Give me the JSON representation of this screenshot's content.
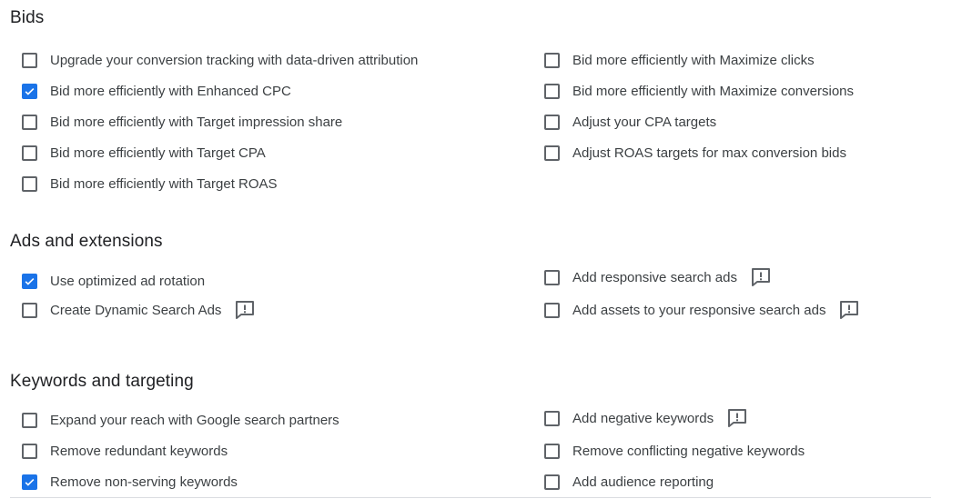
{
  "sections": {
    "bids": {
      "title": "Bids",
      "items": [
        {
          "label": "Upgrade your conversion tracking with data-driven attribution",
          "checked": false
        },
        {
          "label": "Bid more efficiently with Enhanced CPC",
          "checked": true
        },
        {
          "label": "Bid more efficiently with Target impression share",
          "checked": false
        },
        {
          "label": "Bid more efficiently with Target CPA",
          "checked": false
        },
        {
          "label": "Bid more efficiently with Target ROAS",
          "checked": false
        },
        {
          "label": "Bid more efficiently with Maximize clicks",
          "checked": false
        },
        {
          "label": "Bid more efficiently with Maximize conversions",
          "checked": false
        },
        {
          "label": "Adjust your CPA targets",
          "checked": false
        },
        {
          "label": "Adjust ROAS targets for max conversion bids",
          "checked": false
        }
      ]
    },
    "ads": {
      "title": "Ads and extensions",
      "items": [
        {
          "label": "Use optimized ad rotation",
          "checked": true,
          "feedback_icon": false
        },
        {
          "label": "Create Dynamic Search Ads",
          "checked": false,
          "feedback_icon": true
        },
        {
          "label": "Add responsive search ads",
          "checked": false,
          "feedback_icon": true
        },
        {
          "label": "Add assets to your responsive search ads",
          "checked": false,
          "feedback_icon": true
        }
      ]
    },
    "keywords": {
      "title": "Keywords and targeting",
      "items": [
        {
          "label": "Expand your reach with Google search partners",
          "checked": false,
          "feedback_icon": false
        },
        {
          "label": "Remove redundant keywords",
          "checked": false,
          "feedback_icon": false
        },
        {
          "label": "Remove non-serving keywords",
          "checked": true,
          "feedback_icon": false
        },
        {
          "label": "Add negative keywords",
          "checked": false,
          "feedback_icon": true
        },
        {
          "label": "Remove conflicting negative keywords",
          "checked": false,
          "feedback_icon": false
        },
        {
          "label": "Add audience reporting",
          "checked": false,
          "feedback_icon": false
        }
      ]
    }
  },
  "colors": {
    "checkbox_checked": "#1a73e8",
    "checkbox_border": "#5f6368",
    "text": "#3c4043",
    "heading": "#202124"
  },
  "icons": {
    "checkmark": "check-icon",
    "feedback": "feedback-icon"
  }
}
